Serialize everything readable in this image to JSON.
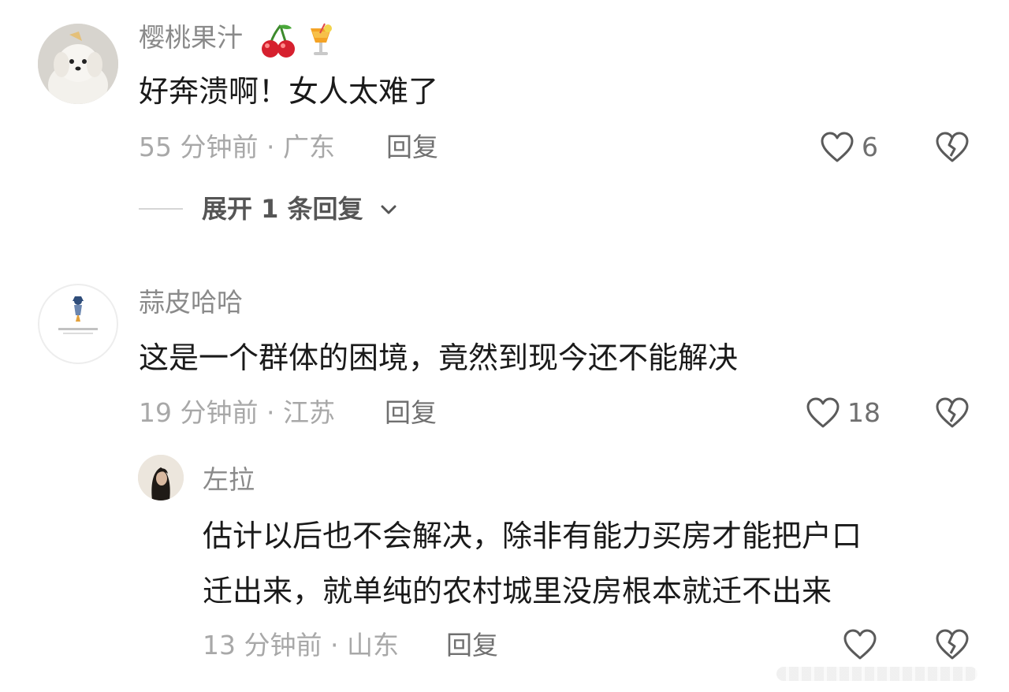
{
  "comments": [
    {
      "username": "樱桃果汁",
      "emojis": [
        "cherry-emoji",
        "tropical-drink-emoji"
      ],
      "text": "好奔溃啊！女人太难了",
      "time_location": "55 分钟前 · 广东",
      "reply_label": "回复",
      "likes": "6",
      "expand_label": "展开 1 条回复"
    },
    {
      "username": "蒜皮哈哈",
      "text": "这是一个群体的困境，竟然到现今还不能解决",
      "time_location": "19 分钟前 · 江苏",
      "reply_label": "回复",
      "likes": "18"
    }
  ],
  "reply": {
    "username": "左拉",
    "text_line1": "估计以后也不会解决，除非有能力买房才能把户口",
    "text_line2": "迁出来，就单纯的农村城里没房根本就迁不出来",
    "time_location": "13 分钟前 · 山东",
    "reply_label": "回复"
  },
  "icons": {
    "like": "heart-outline-icon",
    "dislike": "broken-heart-icon",
    "expand": "chevron-down-icon"
  },
  "colors": {
    "text": "#1a1a1a",
    "username": "#8a8a8a",
    "meta": "#a8a8a8",
    "icon": "#5a5a5a"
  }
}
